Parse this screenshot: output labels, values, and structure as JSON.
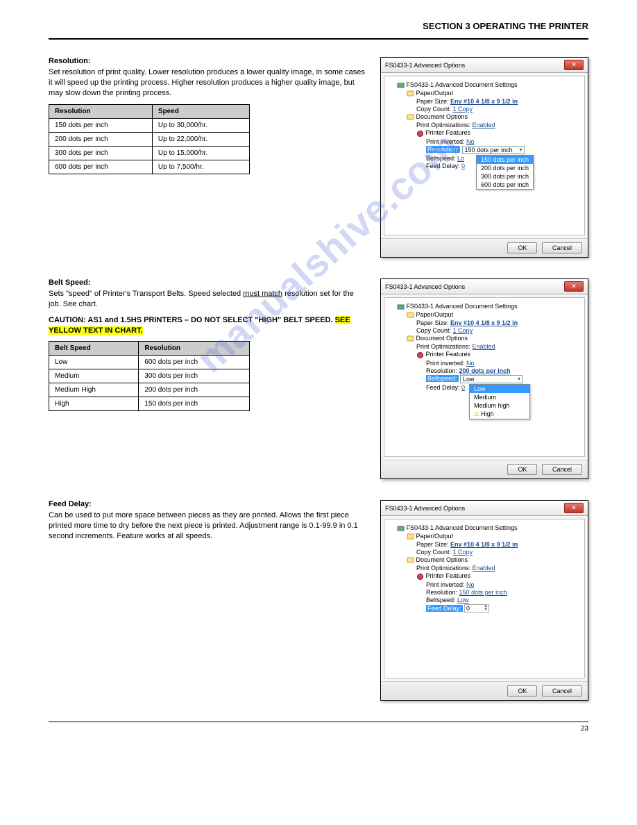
{
  "header": {
    "section": "SECTION 3",
    "title": "OPERATING THE PRINTER"
  },
  "resolution": {
    "heading": "Resolution:",
    "body": "Set resolution of print quality. Lower resolution produces a lower quality image, in some cases it will speed up the printing process. Higher resolution produces a higher quality image, but may slow down the printing process.",
    "table": {
      "headers": [
        "Resolution",
        "Speed"
      ],
      "rows": [
        [
          "150 dots per inch",
          "Up to 30,000/hr."
        ],
        [
          "200 dots per inch",
          "Up to 22,000/hr."
        ],
        [
          "300 dots per inch",
          "Up to 15,000/hr."
        ],
        [
          "600 dots per inch",
          "Up to 7,500/hr."
        ]
      ]
    }
  },
  "beltspeed": {
    "heading": "Belt Speed:",
    "p1_pre": "Sets \"speed\" of Printer's Transport Belts. Speed selected ",
    "p1_underline": "must match",
    "p1_post": " resolution set for the job. See chart.",
    "p2_pre": "CAUTION: AS1 and 1.5HS PRINTERS – DO NOT SELECT \"HIGH\" BELT SPEED. ",
    "p2_hl": "SEE YELLOW TEXT IN CHART.",
    "table": {
      "headers": [
        "Belt Speed",
        "Resolution"
      ],
      "rows": [
        [
          "Low",
          "600 dots per inch"
        ],
        [
          "Medium",
          "300 dots per inch"
        ],
        [
          "Medium High",
          "200 dots per inch"
        ],
        [
          "High",
          "150 dots per inch"
        ]
      ]
    }
  },
  "feeddelay": {
    "heading": "Feed Delay:",
    "body": "Can be used to put more space between pieces as they are printed. Allows the first piece printed more time to dry before the next piece is printed. Adjustment range is 0.1-99.9 in 0.1 second increments. Feature works at all speeds."
  },
  "dialog": {
    "title": "FS0433-1 Advanced Options",
    "root": "FS0433-1 Advanced Document Settings",
    "paper_output": "Paper/Output",
    "paper_size_label": "Paper Size:",
    "paper_size_value": "Env #10 4 1/8 x 9 1/2 in",
    "copy_count_label": "Copy Count:",
    "copy_count_value": "1 Copy",
    "doc_options": "Document Options",
    "print_opt_label": "Print Optimizations:",
    "print_opt_value": "Enabled",
    "printer_features": "Printer Features",
    "print_inverted_label": "Print inverted:",
    "print_inverted_value": "No",
    "resolution_label": "Resolution:",
    "beltspeed_label": "Beltspeed:",
    "feed_delay_label": "Feed Delay:",
    "d1": {
      "resolution_dd_value": "150 dots per inch",
      "beltspeed_value": "Lo",
      "feed_delay_value": "0",
      "options": [
        "150 dots per inch",
        "200 dots per inch",
        "300 dots per inch",
        "600 dots per inch"
      ]
    },
    "d2": {
      "resolution_value": "200 dots per inch",
      "beltspeed_dd_value": "Low",
      "feed_delay_value": "0",
      "options": [
        "Low",
        "Medium",
        "Medium high",
        "High"
      ]
    },
    "d3": {
      "resolution_value": "150 dots per inch",
      "beltspeed_value": "Low",
      "feed_delay_value": "0"
    },
    "ok": "OK",
    "cancel": "Cancel"
  },
  "watermark": "manualshive.com",
  "footer": {
    "page": "23"
  }
}
